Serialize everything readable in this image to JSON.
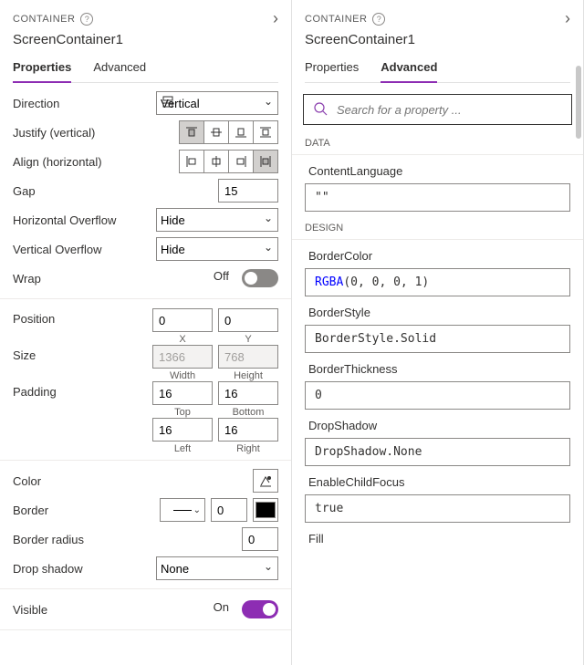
{
  "left": {
    "header_label": "CONTAINER",
    "title": "ScreenContainer1",
    "tabs": {
      "properties": "Properties",
      "advanced": "Advanced"
    },
    "rows": {
      "direction": "Direction",
      "justify": "Justify (vertical)",
      "align": "Align (horizontal)",
      "gap": "Gap",
      "hoverflow": "Horizontal Overflow",
      "voverflow": "Vertical Overflow",
      "wrap": "Wrap",
      "position": "Position",
      "size": "Size",
      "padding": "Padding",
      "color": "Color",
      "border": "Border",
      "borderRadius": "Border radius",
      "dropShadow": "Drop shadow",
      "visible": "Visible"
    },
    "values": {
      "direction": "Vertical",
      "gap": "15",
      "hoverflow": "Hide",
      "voverflow": "Hide",
      "wrap_state": "Off",
      "pos_x": "0",
      "pos_y": "0",
      "size_w": "1366",
      "size_h": "768",
      "pad_t": "16",
      "pad_b": "16",
      "pad_l": "16",
      "pad_r": "16",
      "border_w": "0",
      "border_radius": "0",
      "drop_shadow": "None",
      "visible_state": "On"
    },
    "sublabels": {
      "x": "X",
      "y": "Y",
      "w": "Width",
      "h": "Height",
      "t": "Top",
      "b": "Bottom",
      "l": "Left",
      "r": "Right"
    }
  },
  "right": {
    "header_label": "CONTAINER",
    "title": "ScreenContainer1",
    "tabs": {
      "properties": "Properties",
      "advanced": "Advanced"
    },
    "search_placeholder": "Search for a property ...",
    "sections": {
      "data": "DATA",
      "design": "DESIGN"
    },
    "props": {
      "contentLanguage": {
        "name": "ContentLanguage",
        "value": "\"\""
      },
      "borderColor": {
        "name": "BorderColor",
        "value_fn": "RGBA",
        "value_args": "(0, 0, 0, 1)"
      },
      "borderStyle": {
        "name": "BorderStyle",
        "value": "BorderStyle.Solid"
      },
      "borderThickness": {
        "name": "BorderThickness",
        "value": "0"
      },
      "dropShadow": {
        "name": "DropShadow",
        "value": "DropShadow.None"
      },
      "enableChildFocus": {
        "name": "EnableChildFocus",
        "value": "true"
      },
      "fill": {
        "name": "Fill"
      }
    }
  }
}
